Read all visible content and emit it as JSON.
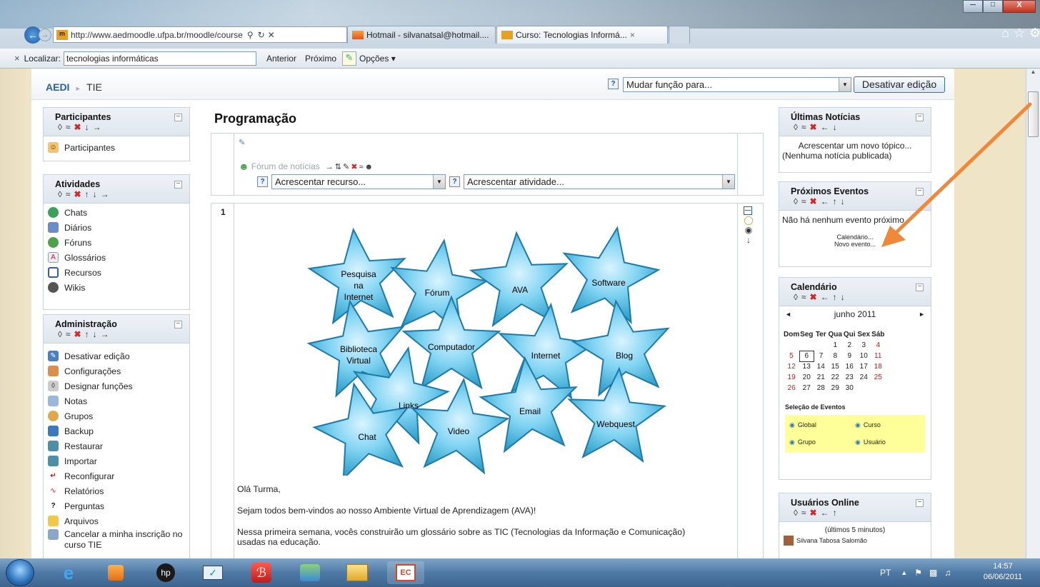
{
  "browser": {
    "url": "http://www.aedmoodle.ufpa.br/moodle/course",
    "tabs": [
      {
        "label": "Hotmail - silvanatsal@hotmail...."
      },
      {
        "label": "Curso: Tecnologias Informá...",
        "close": "×"
      }
    ],
    "findbar": {
      "close": "×",
      "label": "Localizar:",
      "value": "tecnologias informáticas",
      "prev": "Anterior",
      "next": "Próximo",
      "options": "Opções ▾"
    }
  },
  "header": {
    "breadcrumb_home": "AEDI",
    "breadcrumb_sep": "►",
    "breadcrumb_course": "TIE",
    "role_select": "Mudar função para...",
    "edit_button": "Desativar edição"
  },
  "left": {
    "participants": {
      "title": "Participantes",
      "items": [
        "Participantes"
      ]
    },
    "activities": {
      "title": "Atividades",
      "items": [
        "Chats",
        "Diários",
        "Fóruns",
        "Glossários",
        "Recursos",
        "Wikis"
      ]
    },
    "admin": {
      "title": "Administração",
      "items": [
        "Desativar edição",
        "Configurações",
        "Designar funções",
        "Notas",
        "Grupos",
        "Backup",
        "Restaurar",
        "Importar",
        "Reconfigurar",
        "Relatórios",
        "Perguntas",
        "Arquivos",
        "Cancelar a minha inscrição no",
        "curso TIE"
      ]
    }
  },
  "main": {
    "title": "Programação",
    "forum": "Fórum de notícias",
    "add_resource": "Acrescentar recurso...",
    "add_activity": "Acrescentar atividade...",
    "section_number": "1",
    "stars": [
      "Pesquisa",
      "na",
      "Internet",
      "Fórum",
      "AVA",
      "Software",
      "Biblioteca",
      "Virtual",
      "Computador",
      "Internet",
      "Blog",
      "Links",
      "Email",
      "Webquest",
      "Chat",
      "Video"
    ],
    "p1": "Olá Turma,",
    "p2": "Sejam todos bem-vindos ao nosso Ambiente Virtual de Aprendizagem (AVA)!",
    "p3a": "Nessa primeira semana, vocês construirão um glossário sobre as TIC (Tecnologias da Informação e Comunicação)",
    "p3b": "usadas na educação."
  },
  "right": {
    "news": {
      "title": "Últimas Notícias",
      "add": "Acrescentar um novo tópico...",
      "none": "(Nenhuma notícia publicada)"
    },
    "events": {
      "title": "Próximos Eventos",
      "none": "Não há nenhum evento próximo",
      "calendar": "Calendário...",
      "new": "Novo evento..."
    },
    "calendar": {
      "title": "Calendário",
      "month": "junho 2011",
      "prev": "◄",
      "next": "►",
      "days": [
        "Dom",
        "Seg",
        "Ter",
        "Qua",
        "Qui",
        "Sex",
        "Sáb"
      ],
      "weeks": [
        [
          "",
          "",
          "",
          "1",
          "2",
          "3",
          "4"
        ],
        [
          "5",
          "6",
          "7",
          "8",
          "9",
          "10",
          "11"
        ],
        [
          "12",
          "13",
          "14",
          "15",
          "16",
          "17",
          "18"
        ],
        [
          "19",
          "20",
          "21",
          "22",
          "23",
          "24",
          "25"
        ],
        [
          "26",
          "27",
          "28",
          "29",
          "30",
          "",
          ""
        ]
      ],
      "events_title": "Seleção de Eventos",
      "filters": [
        "Global",
        "Curso",
        "Grupo",
        "Usuário"
      ]
    },
    "online": {
      "title": "Usuários Online",
      "period": "(últimos 5 minutos)",
      "user": "Silvana Tabosa Salomão"
    }
  },
  "taskbar": {
    "lang": "PT",
    "time": "14:57",
    "date": "06/06/2011"
  },
  "colors": {
    "accent": "#2a5fa8",
    "star": "#5ec8ec",
    "arrow": "#f0883a",
    "event_panel": "#ffff99"
  }
}
